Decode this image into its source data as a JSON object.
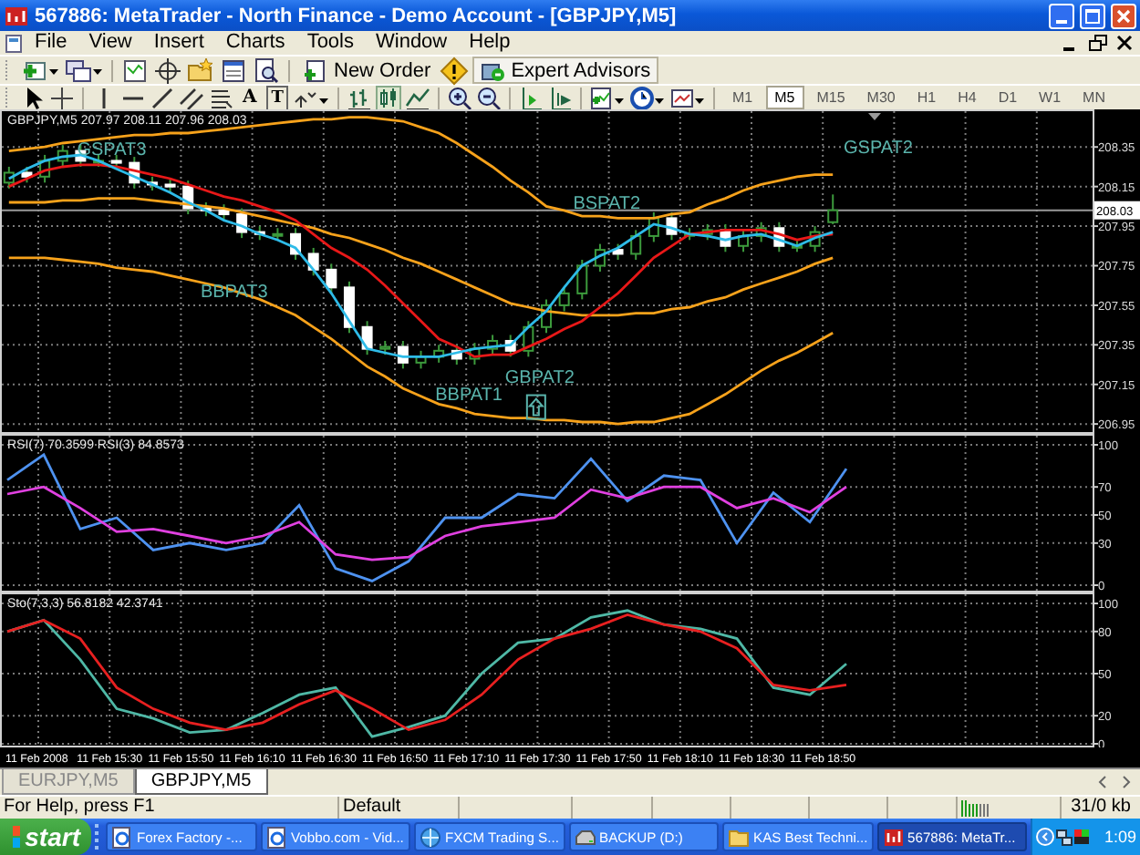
{
  "window": {
    "title": "567886: MetaTrader - North Finance - Demo Account - [GBPJPY,M5]"
  },
  "menu": [
    "File",
    "View",
    "Insert",
    "Charts",
    "Tools",
    "Window",
    "Help"
  ],
  "toolbar": {
    "new_order": "New Order",
    "expert_advisors": "Expert Advisors",
    "text_tool": "A",
    "label_tool": "T"
  },
  "timeframes": [
    {
      "label": "M1",
      "selected": false
    },
    {
      "label": "M5",
      "selected": true
    },
    {
      "label": "M15",
      "selected": false
    },
    {
      "label": "M30",
      "selected": false
    },
    {
      "label": "H1",
      "selected": false
    },
    {
      "label": "H4",
      "selected": false
    },
    {
      "label": "D1",
      "selected": false
    },
    {
      "label": "W1",
      "selected": false
    },
    {
      "label": "MN",
      "selected": false
    }
  ],
  "price_chart": {
    "info": "GBPJPY,M5 207.97 208.11 207.96 208.03",
    "chart_data": {
      "type": "candlestick",
      "grid": true,
      "ylim": [
        206.9,
        208.54
      ],
      "ohlc": [
        [
          208.17,
          208.25,
          208.14,
          208.22
        ],
        [
          208.22,
          208.25,
          208.17,
          208.2
        ],
        [
          208.2,
          208.31,
          208.17,
          208.28
        ],
        [
          208.28,
          208.36,
          208.25,
          208.33
        ],
        [
          208.33,
          208.36,
          208.25,
          208.28
        ],
        [
          208.28,
          208.31,
          208.25,
          208.28
        ],
        [
          208.28,
          208.31,
          208.24,
          208.27
        ],
        [
          208.27,
          208.3,
          208.14,
          208.17
        ],
        [
          208.17,
          208.2,
          208.13,
          208.16
        ],
        [
          208.16,
          208.19,
          208.12,
          208.15
        ],
        [
          208.15,
          208.18,
          208.01,
          208.04
        ],
        [
          208.04,
          208.07,
          208.0,
          208.03
        ],
        [
          208.03,
          208.06,
          207.98,
          208.01
        ],
        [
          208.01,
          208.04,
          207.89,
          207.92
        ],
        [
          207.92,
          207.95,
          207.88,
          207.91
        ],
        [
          207.91,
          207.94,
          207.88,
          207.91
        ],
        [
          207.91,
          207.94,
          207.78,
          207.81
        ],
        [
          207.81,
          207.84,
          207.7,
          207.73
        ],
        [
          207.73,
          207.76,
          207.61,
          207.64
        ],
        [
          207.64,
          207.67,
          207.41,
          207.44
        ],
        [
          207.44,
          207.47,
          207.3,
          207.33
        ],
        [
          207.33,
          207.37,
          207.3,
          207.34
        ],
        [
          207.34,
          207.37,
          207.23,
          207.26
        ],
        [
          207.26,
          207.32,
          207.23,
          207.29
        ],
        [
          207.29,
          207.35,
          207.26,
          207.32
        ],
        [
          207.32,
          207.35,
          207.25,
          207.28
        ],
        [
          207.28,
          207.36,
          207.25,
          207.33
        ],
        [
          207.33,
          207.4,
          207.3,
          207.37
        ],
        [
          207.37,
          207.4,
          207.29,
          207.32
        ],
        [
          207.32,
          207.47,
          207.29,
          207.44
        ],
        [
          207.44,
          207.58,
          207.41,
          207.55
        ],
        [
          207.55,
          207.64,
          207.52,
          207.61
        ],
        [
          207.61,
          207.78,
          207.58,
          207.75
        ],
        [
          207.75,
          207.86,
          207.72,
          207.83
        ],
        [
          207.83,
          207.86,
          207.78,
          207.81
        ],
        [
          207.81,
          207.93,
          207.78,
          207.9
        ],
        [
          207.9,
          208.02,
          207.87,
          207.99
        ],
        [
          207.99,
          208.02,
          207.88,
          207.91
        ],
        [
          207.91,
          207.94,
          207.88,
          207.91
        ],
        [
          207.91,
          207.96,
          207.88,
          207.93
        ],
        [
          207.93,
          207.96,
          207.82,
          207.85
        ],
        [
          207.85,
          207.93,
          207.82,
          207.9
        ],
        [
          207.9,
          207.97,
          207.87,
          207.94
        ],
        [
          207.94,
          207.97,
          207.82,
          207.85
        ],
        [
          207.85,
          207.88,
          207.82,
          207.85
        ],
        [
          207.85,
          207.95,
          207.82,
          207.92
        ],
        [
          207.97,
          208.11,
          207.96,
          208.03
        ],
        null,
        null,
        null,
        null,
        null,
        null,
        null,
        null,
        null,
        null,
        null,
        null,
        null,
        null
      ],
      "yticks": [
        {
          "value": 208.35,
          "label": "208.35"
        },
        {
          "value": 208.15,
          "label": "208.15"
        },
        {
          "value": 207.95,
          "label": "207.95"
        },
        {
          "value": 207.75,
          "label": "207.75"
        },
        {
          "value": 207.55,
          "label": "207.55"
        },
        {
          "value": 207.35,
          "label": "207.35"
        },
        {
          "value": 207.15,
          "label": "207.15"
        },
        {
          "value": 206.95,
          "label": "206.95"
        }
      ],
      "ref_lines": [
        {
          "axis": "y",
          "value": 208.03,
          "label": "208.03"
        }
      ],
      "series": [
        {
          "type": "line",
          "color": "#f7a21b",
          "values": [
            208.33,
            208.34,
            208.35,
            208.37,
            208.38,
            208.39,
            208.4,
            208.41,
            208.41,
            208.42,
            208.42,
            208.43,
            208.44,
            208.45,
            208.46,
            208.47,
            208.48,
            208.49,
            208.49,
            208.5,
            208.5,
            208.49,
            208.48,
            208.45,
            208.42,
            208.37,
            208.31,
            208.25,
            208.18,
            208.12,
            208.05,
            208.03,
            208.0,
            208.0,
            207.99,
            207.99,
            207.99,
            208.01,
            208.02,
            208.06,
            208.09,
            208.13,
            208.16,
            208.18,
            208.2,
            208.21,
            208.21,
            null,
            null,
            null,
            null,
            null,
            null,
            null,
            null,
            null,
            null,
            null,
            null,
            null,
            null
          ]
        },
        {
          "type": "line",
          "color": "#f7a21b",
          "values": [
            208.07,
            208.07,
            208.07,
            208.08,
            208.08,
            208.09,
            208.09,
            208.09,
            208.08,
            208.07,
            208.06,
            208.05,
            208.04,
            208.02,
            208.0,
            207.98,
            207.96,
            207.94,
            207.91,
            207.89,
            207.86,
            207.83,
            207.79,
            207.76,
            207.72,
            207.68,
            207.64,
            207.6,
            207.56,
            207.54,
            207.52,
            207.51,
            207.5,
            207.5,
            207.5,
            207.51,
            207.51,
            207.53,
            207.54,
            207.57,
            207.59,
            207.63,
            207.66,
            207.69,
            207.72,
            207.76,
            207.79,
            null,
            null,
            null,
            null,
            null,
            null,
            null,
            null,
            null,
            null,
            null,
            null,
            null,
            null
          ]
        },
        {
          "type": "line",
          "color": "#f7a21b",
          "values": [
            207.79,
            207.79,
            207.79,
            207.78,
            207.77,
            207.76,
            207.74,
            207.73,
            207.72,
            207.7,
            207.68,
            207.66,
            207.64,
            207.61,
            207.58,
            207.54,
            207.5,
            207.44,
            207.38,
            207.31,
            207.24,
            207.19,
            207.13,
            207.09,
            207.05,
            207.03,
            207.0,
            206.99,
            206.98,
            206.98,
            206.97,
            206.97,
            206.96,
            206.96,
            206.95,
            206.96,
            206.96,
            206.98,
            207.0,
            207.05,
            207.1,
            207.16,
            207.22,
            207.27,
            207.31,
            207.36,
            207.41,
            null,
            null,
            null,
            null,
            null,
            null,
            null,
            null,
            null,
            null,
            null,
            null,
            null,
            null
          ]
        },
        {
          "type": "line",
          "color": "#e81818",
          "values": [
            208.15,
            208.19,
            208.23,
            208.25,
            208.26,
            208.26,
            208.25,
            208.23,
            208.21,
            208.19,
            208.16,
            208.13,
            208.1,
            208.08,
            208.05,
            208.02,
            207.98,
            207.91,
            207.84,
            207.79,
            207.73,
            207.65,
            207.56,
            207.47,
            207.38,
            207.34,
            207.29,
            207.3,
            207.3,
            207.34,
            207.38,
            207.43,
            207.47,
            207.54,
            207.61,
            207.7,
            207.79,
            207.85,
            207.91,
            207.92,
            207.93,
            207.93,
            207.93,
            207.91,
            207.88,
            207.9,
            207.91,
            null,
            null,
            null,
            null,
            null,
            null,
            null,
            null,
            null,
            null,
            null,
            null,
            null,
            null
          ]
        },
        {
          "type": "line",
          "color": "#2ebbe8",
          "values": [
            208.19,
            208.24,
            208.28,
            208.3,
            208.31,
            208.28,
            208.24,
            208.2,
            208.16,
            208.12,
            208.07,
            208.03,
            207.98,
            207.95,
            207.91,
            207.88,
            207.84,
            207.73,
            207.61,
            207.47,
            207.33,
            207.31,
            207.29,
            207.29,
            207.29,
            207.31,
            207.33,
            207.34,
            207.35,
            207.44,
            207.52,
            207.64,
            207.75,
            207.8,
            207.84,
            207.9,
            207.96,
            207.94,
            207.91,
            207.9,
            207.88,
            207.9,
            207.91,
            207.88,
            207.85,
            207.89,
            207.92,
            null,
            null,
            null,
            null,
            null,
            null,
            null,
            null,
            null,
            null,
            null,
            null,
            null,
            null
          ]
        }
      ],
      "annotations": [
        "GSPAT3",
        "BBPAT3",
        "BBPAT1",
        "GBPAT2",
        "BSPAT2",
        "GSPAT2"
      ]
    }
  },
  "rsi_chart": {
    "info": "RSI(7) 70.3599 RSI(3) 84.8573",
    "chart_data": {
      "type": "line",
      "grid": true,
      "ylim": [
        -5.2,
        107.8
      ],
      "yticks": [
        {
          "value": 100,
          "label": "100"
        },
        {
          "value": 70,
          "label": "70"
        },
        {
          "value": 50,
          "label": "50"
        },
        {
          "value": 30,
          "label": "30"
        },
        {
          "value": 0,
          "label": "0"
        }
      ],
      "series": [
        {
          "color": "#4e92f0",
          "values": [
            75,
            93,
            40,
            48,
            25,
            30,
            25,
            30,
            57,
            12,
            3,
            17,
            48,
            48,
            65,
            62,
            90,
            60,
            78,
            75,
            30,
            66,
            45,
            83
          ]
        },
        {
          "color": "#e040e0",
          "values": [
            65,
            70,
            55,
            38,
            40,
            35,
            30,
            35,
            45,
            22,
            18,
            20,
            35,
            42,
            45,
            48,
            68,
            62,
            70,
            70,
            55,
            62,
            52,
            70
          ]
        }
      ]
    }
  },
  "stochastic_chart": {
    "info": "Sto(7,3,3) 56.8182 42.3741",
    "chart_data": {
      "type": "line",
      "grid": true,
      "ylim": [
        -2.6,
        107.8
      ],
      "yticks": [
        {
          "value": 100,
          "label": "100"
        },
        {
          "value": 80,
          "label": "80"
        },
        {
          "value": 50,
          "label": "50"
        },
        {
          "value": 20,
          "label": "20"
        },
        {
          "value": 0,
          "label": "0"
        }
      ],
      "series": [
        {
          "color": "#4fb8a6",
          "values": [
            80,
            88,
            60,
            25,
            18,
            8,
            10,
            22,
            35,
            40,
            5,
            12,
            20,
            50,
            72,
            75,
            90,
            95,
            85,
            82,
            75,
            40,
            35,
            57
          ]
        },
        {
          "color": "#e82020",
          "values": [
            80,
            88,
            75,
            40,
            25,
            15,
            10,
            15,
            28,
            38,
            25,
            10,
            17,
            35,
            60,
            75,
            82,
            92,
            85,
            80,
            68,
            42,
            38,
            42
          ]
        }
      ]
    }
  },
  "time_axis": [
    "11 Feb 2008",
    "11 Feb 15:30",
    "11 Feb 15:50",
    "11 Feb 16:10",
    "11 Feb 16:30",
    "11 Feb 16:50",
    "11 Feb 17:10",
    "11 Feb 17:30",
    "11 Feb 17:50",
    "11 Feb 18:10",
    "11 Feb 18:30",
    "11 Feb 18:50"
  ],
  "chart_tabs": [
    {
      "label": "EURJPY,M5",
      "selected": false
    },
    {
      "label": "GBPJPY,M5",
      "selected": true
    }
  ],
  "status_bar": {
    "help": "For Help, press F1",
    "profile": "Default",
    "traffic": "31/0 kb"
  },
  "taskbar": {
    "start": "start",
    "items": [
      {
        "label": "Forex Factory -...",
        "kind": "browser",
        "selected": false
      },
      {
        "label": "Vobbo.com - Vid...",
        "kind": "browser",
        "selected": false
      },
      {
        "label": "FXCM Trading S...",
        "kind": "app",
        "selected": false
      },
      {
        "label": "BACKUP (D:)",
        "kind": "drive",
        "selected": false
      },
      {
        "label": "KAS Best Techni...",
        "kind": "folder",
        "selected": false
      },
      {
        "label": "567886: MetaTr...",
        "kind": "terminal",
        "selected": true
      }
    ],
    "clock": "1:09"
  }
}
